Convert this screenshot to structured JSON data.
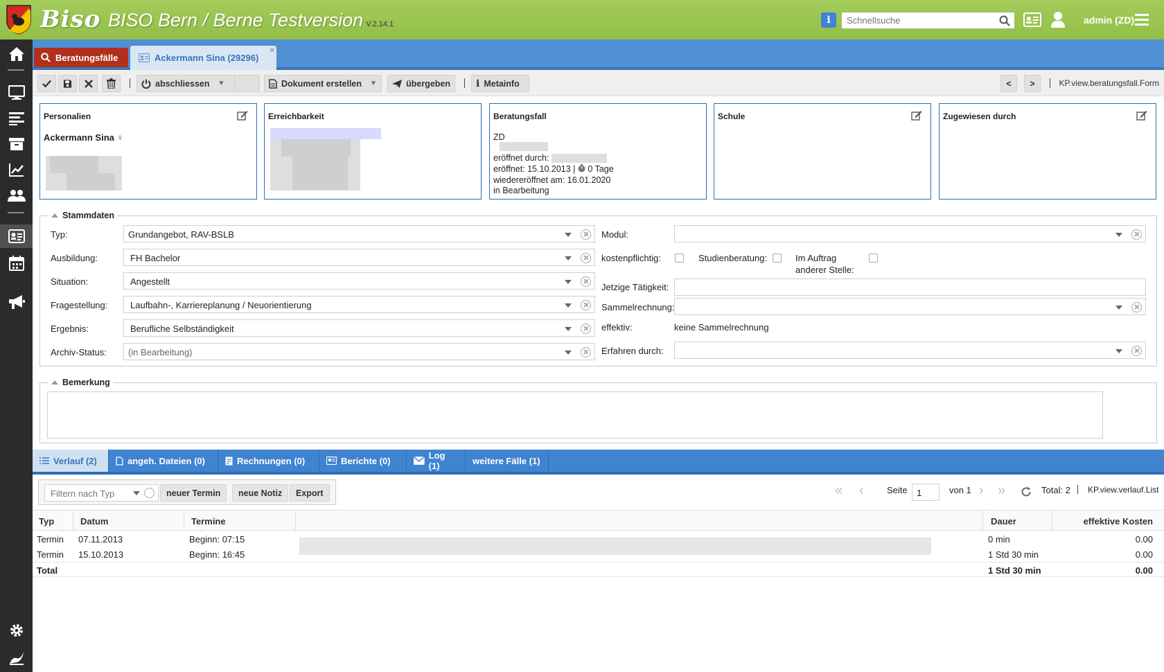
{
  "header": {
    "logo": "Biso",
    "title": "BISO Bern / Berne Testversion",
    "version": "V.2.14.1",
    "search_placeholder": "Schnellsuche",
    "user": "admin (ZD)"
  },
  "tabs": {
    "search_tab": "Beratungsfälle",
    "case_tab": "Ackermann Sina (29296)",
    "close": "×"
  },
  "toolbar": {
    "close_case": "abschliessen",
    "create_doc": "Dokument erstellen",
    "hand_over": "übergeben",
    "metainfo": "Metainfo",
    "prev": "<",
    "next": ">",
    "view_id": "KP.view.beratungsfall.Form"
  },
  "cards": {
    "personalien": {
      "title": "Personalien",
      "name": "Ackermann Sina",
      "gender": "♀"
    },
    "erreichbarkeit": {
      "title": "Erreichbarkeit"
    },
    "beratungsfall": {
      "title": "Beratungsfall",
      "code": "ZD",
      "opened_by": "eröffnet durch: ",
      "opened": "eröffnet: 15.10.2013 | ",
      "days": "0 Tage",
      "reopened": "wiedereröffnet am: 16.01.2020",
      "status": "in Bearbeitung"
    },
    "schule": {
      "title": "Schule"
    },
    "zugewiesen": {
      "title": "Zugewiesen durch"
    }
  },
  "stammdaten": {
    "legend": "Stammdaten",
    "typ": {
      "label": "Typ:",
      "value": "Grundangebot, RAV-BSLB"
    },
    "ausbildung": {
      "label": "Ausbildung:",
      "value": "FH Bachelor"
    },
    "situation": {
      "label": "Situation:",
      "value": "Angestellt"
    },
    "fragestellung": {
      "label": "Fragestellung:",
      "value": "Laufbahn-, Karriereplanung / Neuorientierung"
    },
    "ergebnis": {
      "label": "Ergebnis:",
      "value": "Berufliche Selbständigkeit"
    },
    "archiv": {
      "label": "Archiv-Status:",
      "value": "(in Bearbeitung)"
    },
    "modul": {
      "label": "Modul:",
      "value": ""
    },
    "kostenpflichtig": {
      "label": "kostenpflichtig:",
      "checked": false
    },
    "studienberatung": {
      "label": "Studienberatung:",
      "checked": false
    },
    "auftrag": {
      "label_line1": "Im Auftrag",
      "label_line2": "anderer Stelle:",
      "checked": false
    },
    "taetigkeit": {
      "label": "Jetzige Tätigkeit:",
      "value": ""
    },
    "sammelrechnung": {
      "label": "Sammelrechnung:",
      "value": ""
    },
    "effektiv": {
      "label": "effektiv:",
      "value": "keine Sammelrechnung"
    },
    "erfahren": {
      "label": "Erfahren durch:",
      "value": ""
    }
  },
  "bemerkung": {
    "legend": "Bemerkung",
    "value": ""
  },
  "bottom_tabs": [
    {
      "label": "Verlauf (2)"
    },
    {
      "label": "angeh. Dateien (0)"
    },
    {
      "label": "Rechnungen (0)"
    },
    {
      "label": "Berichte (0)"
    },
    {
      "label": "Log (1)"
    },
    {
      "label": "weitere Fälle (1)"
    }
  ],
  "list_toolbar": {
    "filter_placeholder": "Filtern nach Typ",
    "new_appointment": "neuer Termin",
    "new_note": "neue Notiz",
    "export": "Export",
    "page_label": "Seite",
    "page": "1",
    "of_pages": "von 1",
    "total": "Total: 2",
    "view_id": "KP.view.verlauf.List"
  },
  "table": {
    "columns": [
      "Typ",
      "Datum",
      "Termine",
      "Dauer",
      "effektive Kosten"
    ],
    "rows": [
      {
        "typ": "Termin",
        "datum": "07.11.2013",
        "termine": "Beginn: 07:15",
        "dauer": "0 min",
        "kosten": "0.00"
      },
      {
        "typ": "Termin",
        "datum": "15.10.2013",
        "termine": "Beginn: 16:45",
        "dauer": "1 Std 30 min",
        "kosten": "0.00"
      }
    ],
    "total": {
      "label": "Total",
      "dauer": "1 Std 30 min",
      "kosten": "0.00"
    }
  },
  "icons": {
    "sidebar": [
      "home-icon",
      "monitor-icon",
      "list-icon",
      "archive-icon",
      "chart-icon",
      "users-icon",
      "contact-card-icon",
      "calendar-icon",
      "megaphone-icon",
      "gear-icon",
      "bernese-logo-icon"
    ]
  },
  "colors": {
    "header_green": "#9cc653",
    "tab_blue": "#4f8fd3",
    "search_tab_red": "#b1301d",
    "card_border": "#2a6bbd"
  }
}
